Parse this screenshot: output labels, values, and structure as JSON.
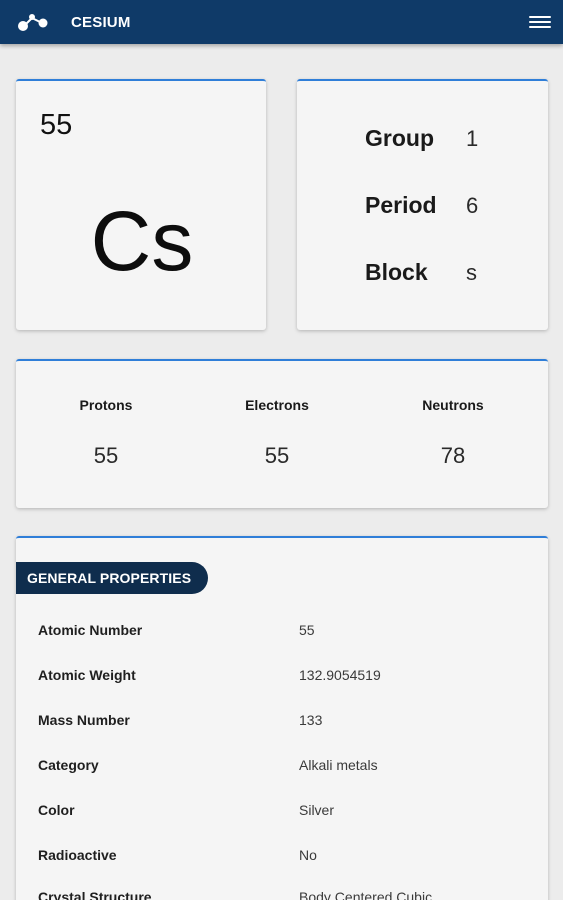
{
  "appbar": {
    "title": "CESIUM",
    "logo_icon": "molecule-icon",
    "menu_icon": "hamburger-menu-icon",
    "background": "#0f3a68"
  },
  "element": {
    "atomic_number": "55",
    "symbol": "Cs"
  },
  "position": [
    {
      "label": "Group",
      "value": "1"
    },
    {
      "label": "Period",
      "value": "6"
    },
    {
      "label": "Block",
      "value": "s"
    }
  ],
  "particles": [
    {
      "label": "Protons",
      "value": "55"
    },
    {
      "label": "Electrons",
      "value": "55"
    },
    {
      "label": "Neutrons",
      "value": "78"
    }
  ],
  "general_properties": {
    "heading": "GENERAL PROPERTIES",
    "rows": [
      {
        "label": "Atomic Number",
        "value": "55"
      },
      {
        "label": "Atomic Weight",
        "value": "132.9054519"
      },
      {
        "label": "Mass Number",
        "value": "133"
      },
      {
        "label": "Category",
        "value": "Alkali metals"
      },
      {
        "label": "Color",
        "value": "Silver"
      },
      {
        "label": "Radioactive",
        "value": "No"
      },
      {
        "label": "Crystal Structure",
        "value": "Body Centered Cubic"
      }
    ]
  },
  "colors": {
    "accent": "#2f7ed8",
    "badge": "#0f2d4d",
    "card": "#f5f5f5",
    "background": "#ececec"
  }
}
